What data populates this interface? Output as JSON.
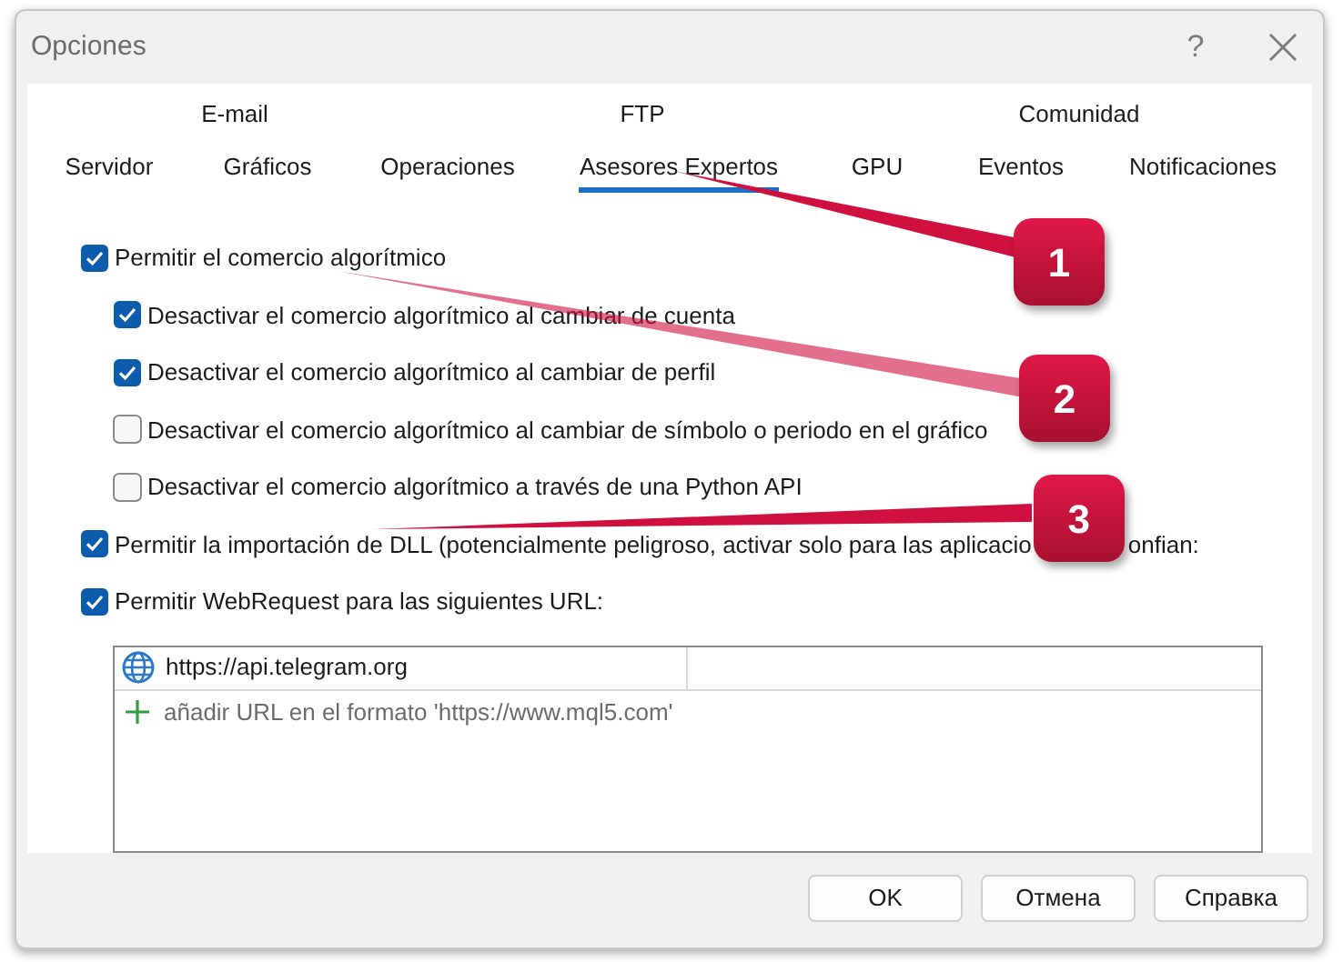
{
  "window": {
    "title": "Opciones",
    "help": "?"
  },
  "tab_rows": [
    [
      {
        "label": "E-mail",
        "selected": false
      },
      {
        "label": "FTP",
        "selected": false
      },
      {
        "label": "Comunidad",
        "selected": false
      }
    ],
    [
      {
        "label": "Servidor",
        "selected": false
      },
      {
        "label": "Gráficos",
        "selected": false
      },
      {
        "label": "Operaciones",
        "selected": false
      },
      {
        "label": "Asesores Expertos",
        "selected": true
      },
      {
        "label": "GPU",
        "selected": false
      },
      {
        "label": "Eventos",
        "selected": false
      },
      {
        "label": "Notificaciones",
        "selected": false
      }
    ]
  ],
  "options": [
    {
      "label": "Permitir el comercio algorítmico",
      "checked": true,
      "children": [
        {
          "label": "Desactivar el comercio algorítmico al cambiar de cuenta",
          "checked": true
        },
        {
          "label": "Desactivar el comercio algorítmico al cambiar de perfil",
          "checked": true
        },
        {
          "label": "Desactivar el comercio algorítmico al cambiar de símbolo o periodo en el gráfico",
          "checked": false
        },
        {
          "label": "Desactivar el comercio algorítmico a través de una Python API",
          "checked": false
        }
      ]
    },
    {
      "label": "Permitir la importación de DLL (potencialmente peligroso, activar solo para las aplicacio",
      "label_end": "onfian:",
      "checked": true
    },
    {
      "label": "Permitir WebRequest para las siguientes URL:",
      "checked": true
    }
  ],
  "url_list": [
    {
      "kind": "url",
      "text": "https://api.telegram.org"
    },
    {
      "kind": "add",
      "text": "añadir URL en el formato 'https://www.mql5.com'"
    }
  ],
  "buttons": [
    "OK",
    "Отмена",
    "Справка"
  ],
  "annotations": [
    {
      "label": "1"
    },
    {
      "label": "2"
    },
    {
      "label": "3"
    }
  ]
}
